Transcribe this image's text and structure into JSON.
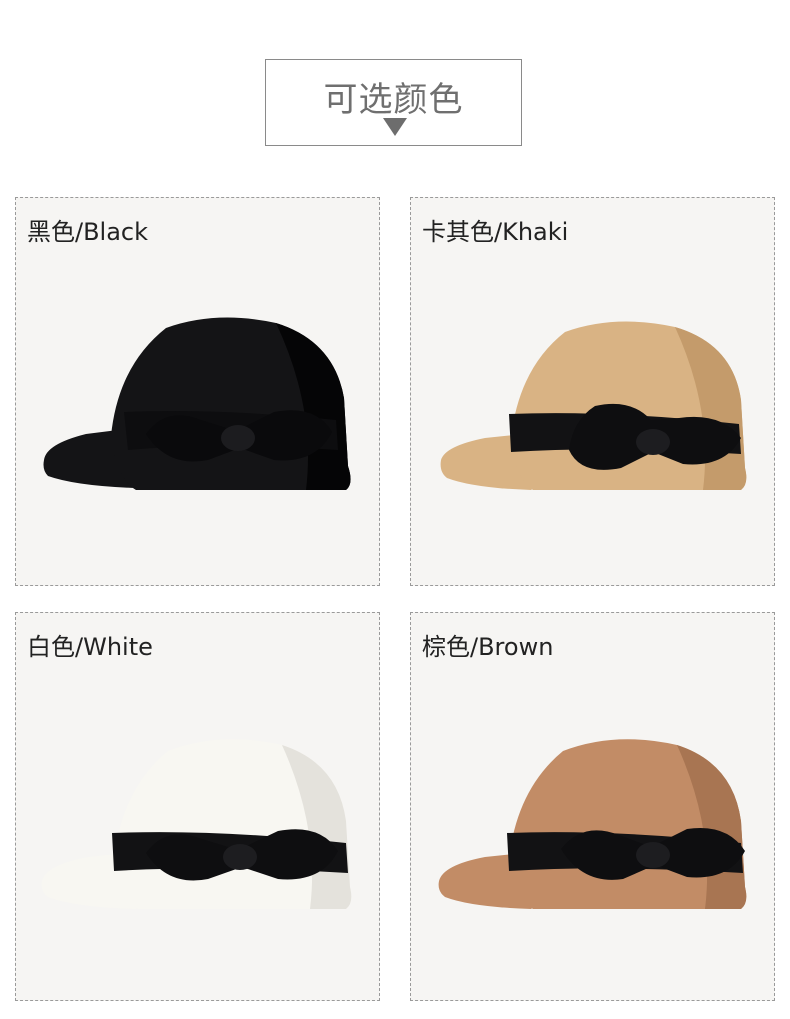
{
  "header": {
    "title": "可选颜色"
  },
  "colors": [
    {
      "label": "黑色/Black",
      "felt": "#141416",
      "felt_shade": "#050506",
      "ribbon": "#0d0d0f"
    },
    {
      "label": "卡其色/Khaki",
      "felt": "#d9b384",
      "felt_shade": "#c49b6b",
      "ribbon": "#121214"
    },
    {
      "label": "白色/White",
      "felt": "#f8f7f2",
      "felt_shade": "#e4e2dc",
      "ribbon": "#121214"
    },
    {
      "label": "棕色/Brown",
      "felt": "#c28c66",
      "felt_shade": "#a87552",
      "ribbon": "#121214"
    }
  ]
}
